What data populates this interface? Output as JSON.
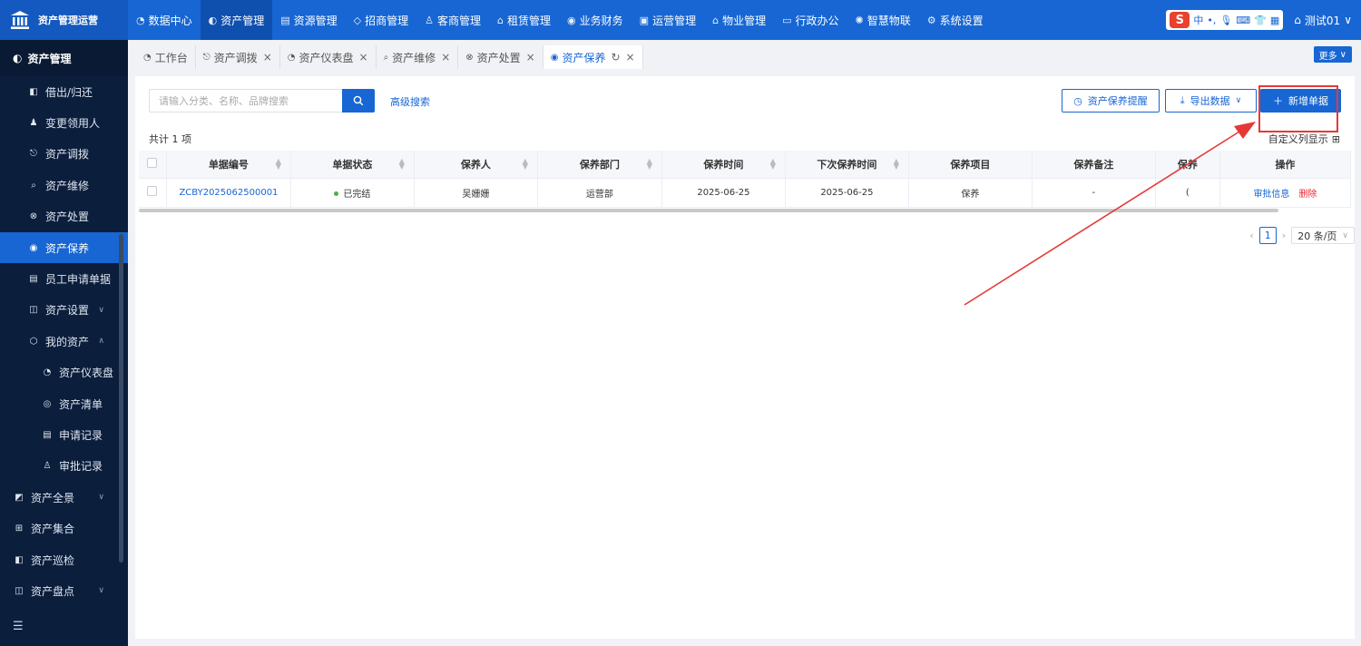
{
  "app": {
    "name": "资产管理运营"
  },
  "nav": [
    {
      "icon": "◔",
      "label": "数据中心"
    },
    {
      "icon": "◐",
      "label": "资产管理",
      "active": true
    },
    {
      "icon": "▤",
      "label": "资源管理"
    },
    {
      "icon": "◇",
      "label": "招商管理"
    },
    {
      "icon": "♙",
      "label": "客商管理"
    },
    {
      "icon": "⌂",
      "label": "租赁管理"
    },
    {
      "icon": "◉",
      "label": "业务财务"
    },
    {
      "icon": "▣",
      "label": "运营管理"
    },
    {
      "icon": "⌂",
      "label": "物业管理"
    },
    {
      "icon": "▭",
      "label": "行政办公"
    },
    {
      "icon": "✺",
      "label": "智慧物联"
    },
    {
      "icon": "⚙",
      "label": "系统设置"
    }
  ],
  "ime": {
    "logo": "S",
    "mode": "中",
    "punct": "•,"
  },
  "user": {
    "name": "测试01"
  },
  "sidebar": {
    "header": "资产管理",
    "items": [
      {
        "icon": "◧",
        "label": "借出/归还"
      },
      {
        "icon": "♟",
        "label": "变更领用人"
      },
      {
        "icon": "⎋",
        "label": "资产调拨"
      },
      {
        "icon": "⌕",
        "label": "资产维修"
      },
      {
        "icon": "⊗",
        "label": "资产处置"
      },
      {
        "icon": "◉",
        "label": "资产保养",
        "active": true
      },
      {
        "icon": "▤",
        "label": "员工申请单据"
      },
      {
        "icon": "◫",
        "label": "资产设置",
        "chevron": "∨"
      },
      {
        "icon": "⬡",
        "label": "我的资产",
        "chevron": "∧"
      }
    ],
    "sub_items": [
      {
        "icon": "◔",
        "label": "资产仪表盘"
      },
      {
        "icon": "◎",
        "label": "资产清单"
      },
      {
        "icon": "▤",
        "label": "申请记录"
      },
      {
        "icon": "♙",
        "label": "审批记录"
      }
    ],
    "bottom_items": [
      {
        "icon": "◩",
        "label": "资产全景",
        "chevron": "∨"
      },
      {
        "icon": "⊞",
        "label": "资产集合"
      },
      {
        "icon": "◧",
        "label": "资产巡检"
      },
      {
        "icon": "◫",
        "label": "资产盘点",
        "chevron": "∨"
      }
    ]
  },
  "tabs": [
    {
      "icon": "◔",
      "label": "工作台",
      "closable": false
    },
    {
      "icon": "⎋",
      "label": "资产调拨",
      "closable": true
    },
    {
      "icon": "◔",
      "label": "资产仪表盘",
      "closable": true
    },
    {
      "icon": "⌕",
      "label": "资产维修",
      "closable": true
    },
    {
      "icon": "⊗",
      "label": "资产处置",
      "closable": true
    },
    {
      "icon": "◉",
      "label": "资产保养",
      "closable": true,
      "active": true
    }
  ],
  "more_label": "更多",
  "toolbar": {
    "search_placeholder": "请输入分类、名称、品牌搜索",
    "advanced_search": "高级搜索",
    "reminder_btn": "资产保养提醒",
    "export_btn": "导出数据",
    "add_btn": "新增单据"
  },
  "summary": {
    "count_text": "共计 1 项",
    "custom_columns": "自定义列显示"
  },
  "table": {
    "columns": [
      "单据编号",
      "单据状态",
      "保养人",
      "保养部门",
      "保养时间",
      "下次保养时间",
      "保养项目",
      "保养备注",
      "保养",
      "操作"
    ],
    "rows": [
      {
        "code": "ZCBY2025062500001",
        "status": "已完结",
        "person": "吴姗姗",
        "dept": "运营部",
        "time": "2025-06-25",
        "next_time": "2025-06-25",
        "item": "保养",
        "remark": "-",
        "extra": "(",
        "op_audit": "审批信息",
        "op_delete": "删除"
      }
    ]
  },
  "pagination": {
    "current": "1",
    "page_size": "20 条/页"
  },
  "colors": {
    "primary": "#1766d3",
    "sidebar_bg": "#0b1e3c",
    "danger": "#f5222d",
    "annotation": "#e53935"
  }
}
